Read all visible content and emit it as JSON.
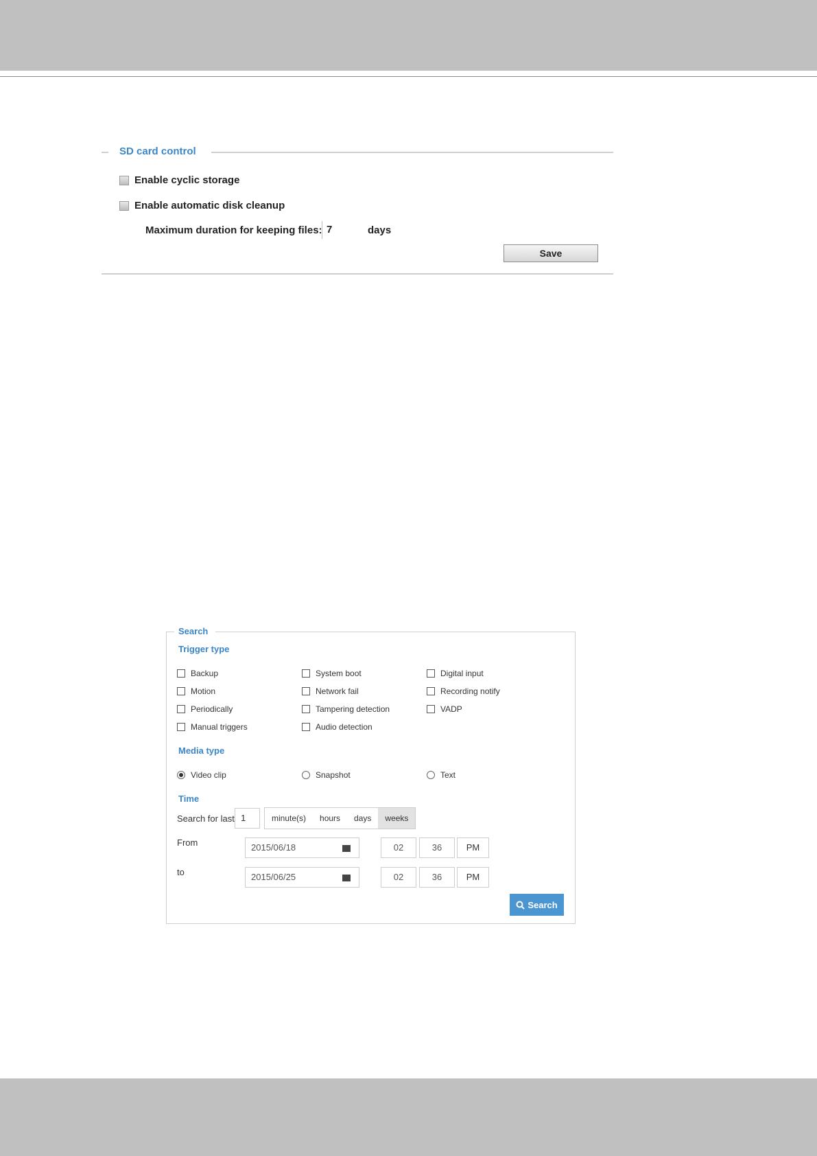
{
  "sd_card_control": {
    "legend": "SD card control",
    "cyclic_storage_label": "Enable cyclic storage",
    "cyclic_storage_checked": false,
    "disk_cleanup_label": "Enable automatic disk cleanup",
    "disk_cleanup_checked": false,
    "max_duration_label": "Maximum duration for keeping files:",
    "max_duration_value": "7",
    "days_label": "days",
    "save_label": "Save"
  },
  "search_panel": {
    "legend": "Search",
    "trigger_type": {
      "title": "Trigger type",
      "options": [
        "Backup",
        "System boot",
        "Digital input",
        "Motion",
        "Network fail",
        "Recording notify",
        "Periodically",
        "Tampering detection",
        "VADP",
        "Manual triggers",
        "Audio detection"
      ]
    },
    "media_type": {
      "title": "Media type",
      "options": [
        "Video clip",
        "Snapshot",
        "Text"
      ],
      "selected": "Video clip"
    },
    "time": {
      "title": "Time",
      "search_for_last_label": "Search for last",
      "search_for_last_value": "1",
      "units": [
        "minute(s)",
        "hours",
        "days",
        "weeks"
      ],
      "active_unit": "weeks",
      "from_label": "From",
      "from_date": "2015/06/18",
      "from_hour": "02",
      "from_minute": "36",
      "from_ampm": "PM",
      "to_label": "to",
      "to_date": "2015/06/25",
      "to_hour": "02",
      "to_minute": "36",
      "to_ampm": "PM"
    },
    "search_button": "Search"
  }
}
